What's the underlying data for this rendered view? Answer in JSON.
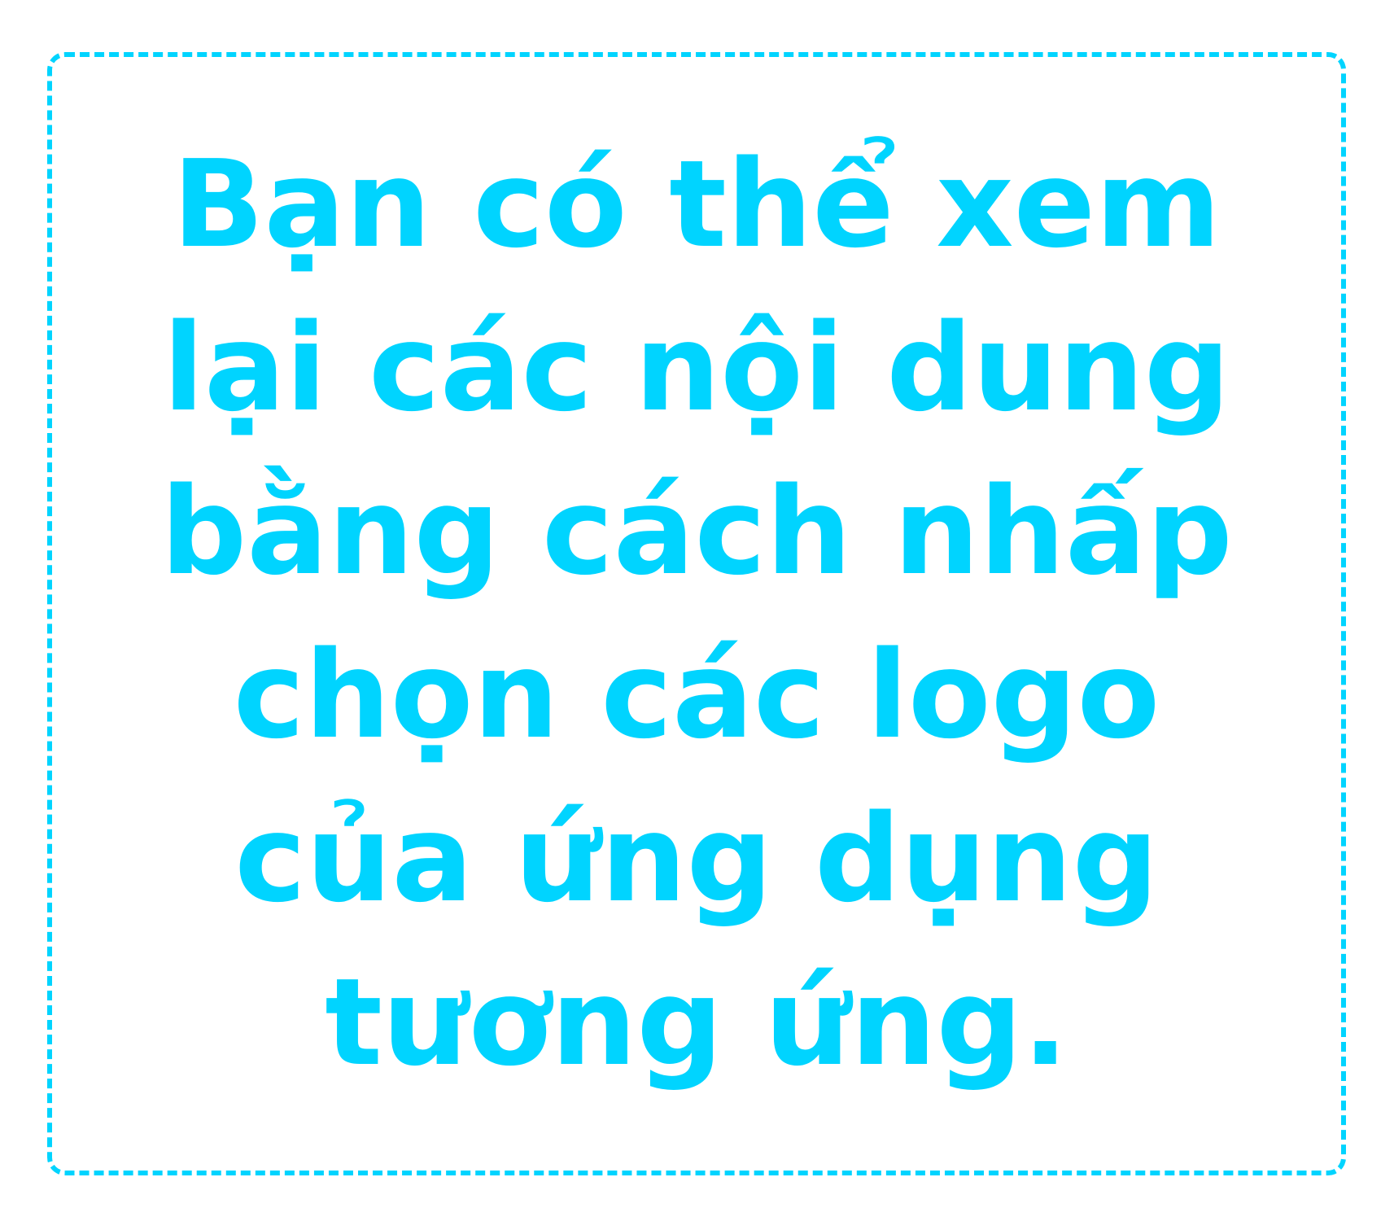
{
  "colors": {
    "accent": "#00d4ff",
    "background": "#ffffff"
  },
  "message": {
    "lines": [
      "Bạn có thể xem",
      "lại các nội dung",
      "bằng cách nhấp",
      "chọn các logo",
      "của ứng dụng",
      "tương ứng."
    ]
  }
}
